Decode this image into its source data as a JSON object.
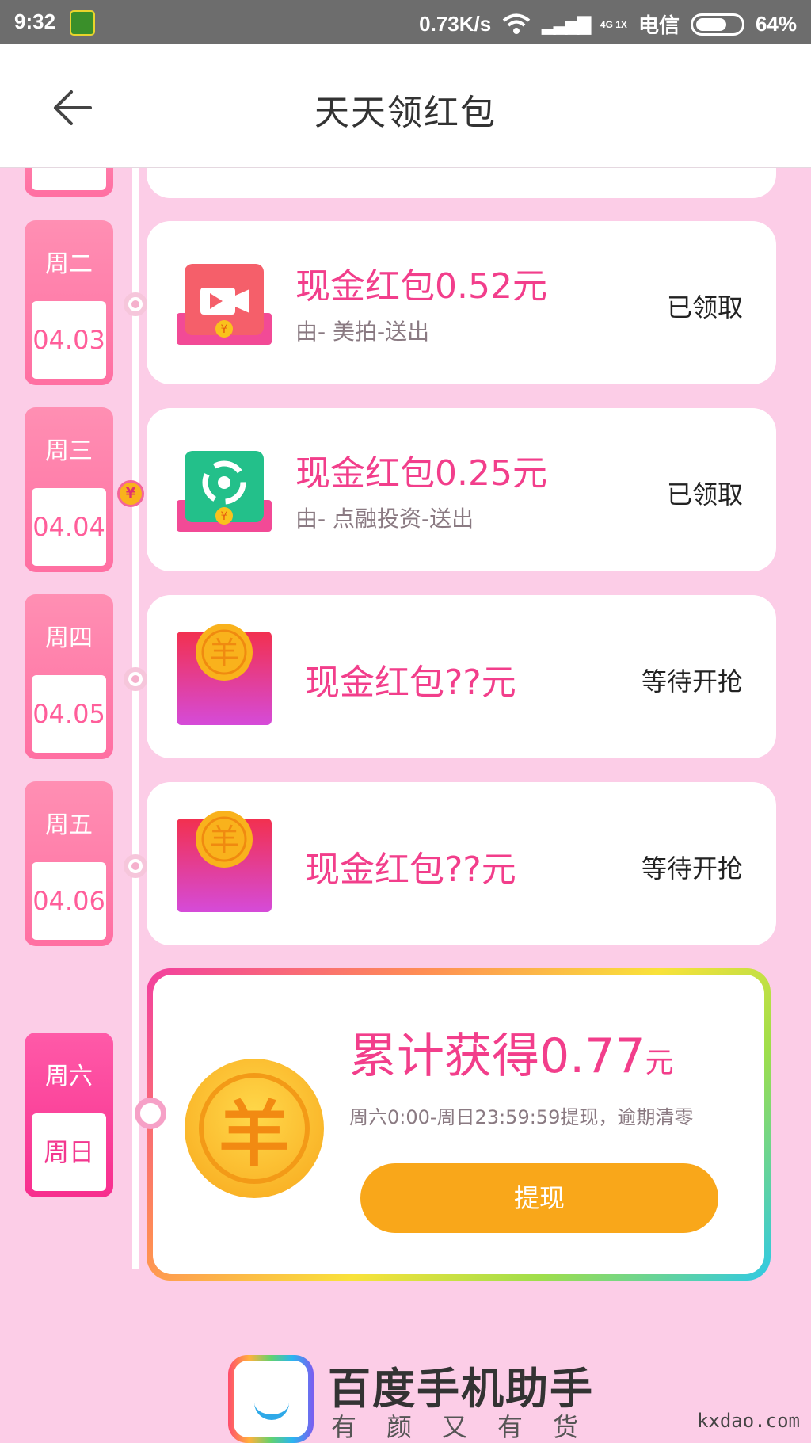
{
  "status_bar": {
    "time": "9:32",
    "speed": "0.73K/s",
    "network": "4G 1X",
    "carrier": "电信",
    "battery": "64%"
  },
  "header": {
    "title": "天天领红包"
  },
  "days": [
    {
      "weekday": "周二",
      "date": "04.03",
      "amount": "现金红包0.52元",
      "from": "由- 美拍-送出",
      "state": "已领取",
      "icon": "meipai-video-icon"
    },
    {
      "weekday": "周三",
      "date": "04.04",
      "amount": "现金红包0.25元",
      "from": "由- 点融投资-送出",
      "state": "已领取",
      "icon": "dianrong-icon"
    },
    {
      "weekday": "周四",
      "date": "04.05",
      "amount": "现金红包??元",
      "from": "",
      "state": "等待开抢",
      "icon": "red-envelope-icon"
    },
    {
      "weekday": "周五",
      "date": "04.06",
      "amount": "现金红包??元",
      "from": "",
      "state": "等待开抢",
      "icon": "red-envelope-icon"
    }
  ],
  "weekend": {
    "weekday": "周六",
    "date": "周日",
    "total_label": "累计获得0.77",
    "total_unit": "元",
    "note": "周六0:00-周日23:59:59提现，逾期清零",
    "withdraw_label": "提现"
  },
  "brand": {
    "name": "百度手机助手",
    "slogan": "有颜又有货"
  },
  "watermark": "kxdao.com",
  "colors": {
    "accent": "#f23e8b",
    "background": "#fccde7",
    "button": "#f9a71a"
  }
}
